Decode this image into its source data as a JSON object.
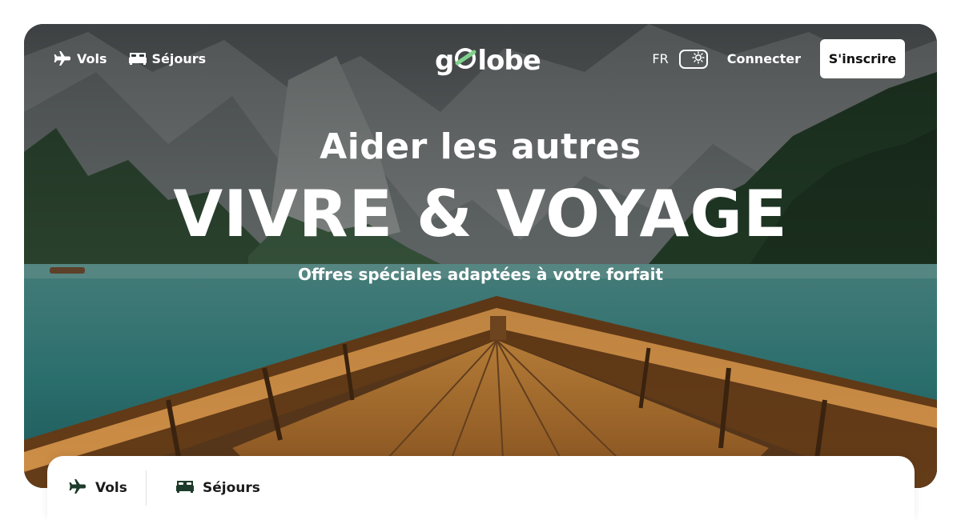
{
  "nav": {
    "flights_label": "Vols",
    "stays_label": "Séjours",
    "language": "FR",
    "login_label": "Connecter",
    "signup_label": "S'inscrire"
  },
  "brand": {
    "logo_g": "g",
    "logo_rest": "lobe",
    "accent_color": "#7fd18c"
  },
  "hero": {
    "subtitle": "Aider les autres",
    "title": "VIVRE & VOYAGE",
    "tagline": "Offres spéciales adaptées à votre forfait"
  },
  "search_tabs": [
    {
      "label": "Vols",
      "icon": "plane-icon"
    },
    {
      "label": "Séjours",
      "icon": "bed-icon"
    }
  ]
}
